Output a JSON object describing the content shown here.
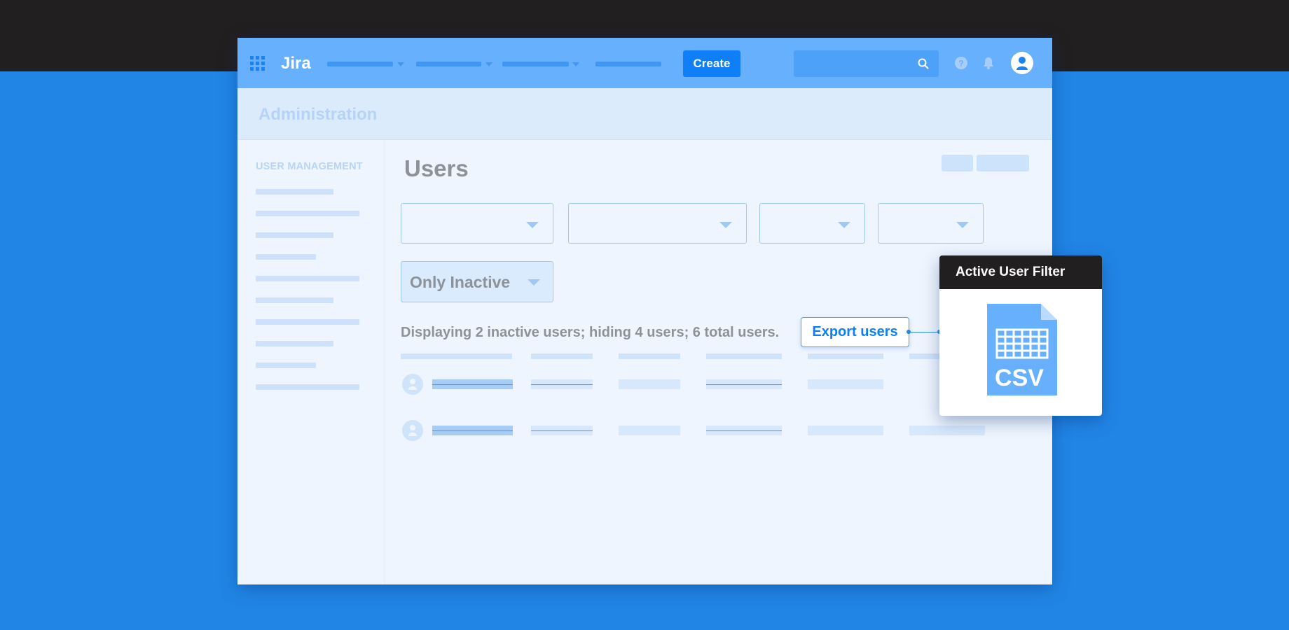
{
  "navbar": {
    "logo": "Jira",
    "create_label": "Create",
    "accent_color": "#0e7ff7",
    "icons": [
      "app-switcher-icon",
      "search-icon",
      "help-icon",
      "bell-icon",
      "user-avatar-icon"
    ]
  },
  "admin": {
    "title": "Administration"
  },
  "sidebar": {
    "heading": "USER MANAGEMENT"
  },
  "main": {
    "title": "Users",
    "status_filter": "Only Inactive",
    "summary": "Displaying 2 inactive users; hiding 4 users; 6 total users.",
    "export_label": "Export users"
  },
  "callout": {
    "title": "Active User Filter",
    "file_label": "CSV"
  }
}
